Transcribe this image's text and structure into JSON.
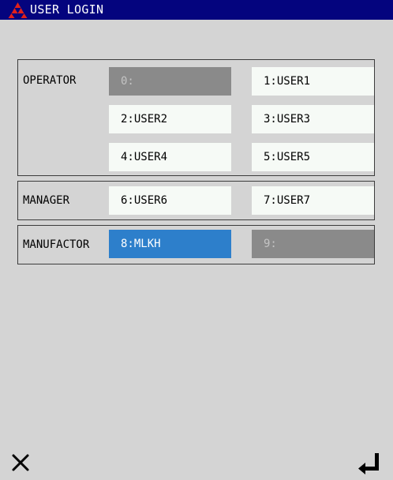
{
  "header": {
    "title": "USER LOGIN",
    "logo_icon": "red-triangle-diamond-logo",
    "bar_color": "#04047e"
  },
  "groups": {
    "operator": {
      "label": "OPERATOR",
      "users": [
        {
          "label": "0:",
          "state": "disabled"
        },
        {
          "label": "1:USER1",
          "state": "normal"
        },
        {
          "label": "2:USER2",
          "state": "normal"
        },
        {
          "label": "3:USER3",
          "state": "normal"
        },
        {
          "label": "4:USER4",
          "state": "normal"
        },
        {
          "label": "5:USER5",
          "state": "normal"
        }
      ]
    },
    "manager": {
      "label": "MANAGER",
      "users": [
        {
          "label": "6:USER6",
          "state": "normal"
        },
        {
          "label": "7:USER7",
          "state": "normal"
        }
      ]
    },
    "manufactor": {
      "label": "MANUFACTOR",
      "users": [
        {
          "label": "8:MLKH",
          "state": "selected"
        },
        {
          "label": "9:",
          "state": "disabled"
        }
      ]
    }
  },
  "footer": {
    "cancel_icon": "close-icon",
    "confirm_icon": "enter-return-icon"
  },
  "colors": {
    "selected": "#2d7fcb",
    "disabled": "#8a8a8a",
    "normal": "#f6faf6",
    "background": "#d4d4d4"
  }
}
